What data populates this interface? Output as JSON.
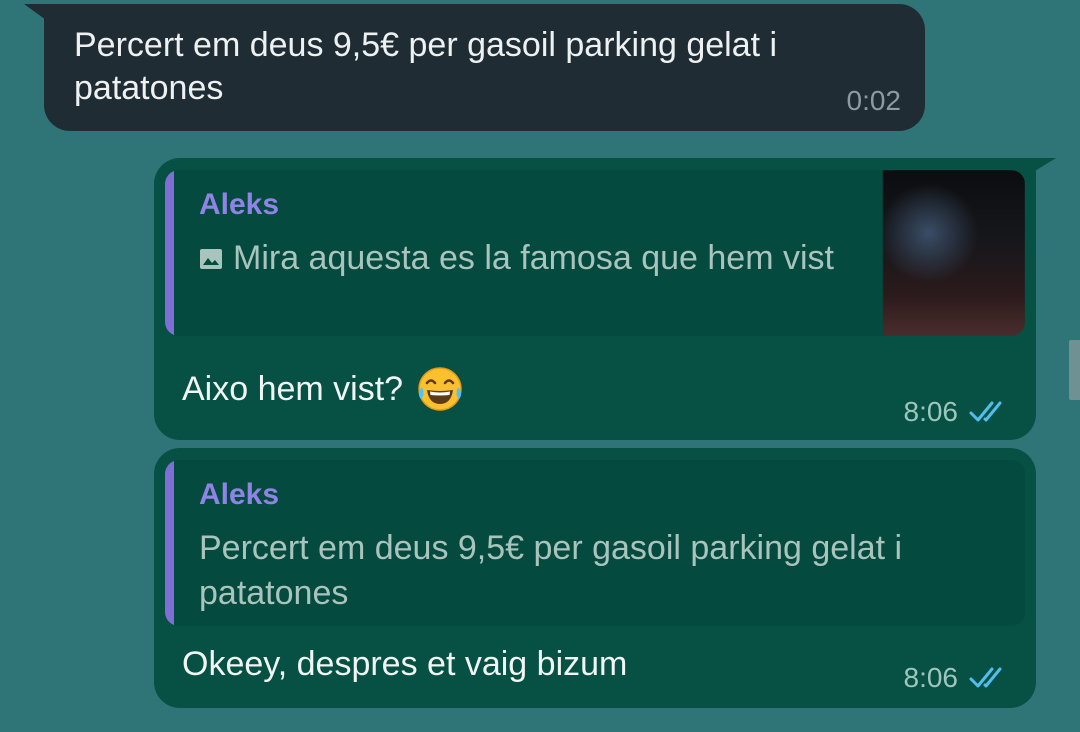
{
  "incoming_message": {
    "text": "Percert em deus 9,5€ per gasoil parking gelat i patatones",
    "time": "0:02"
  },
  "outgoing_messages": [
    {
      "quote": {
        "author": "Aleks",
        "text": "Mira aquesta es la famosa que hem vist",
        "media_icon": "photo-icon",
        "has_thumbnail": true
      },
      "text": "Aixo hem vist?",
      "emoji": "face-with-tears-of-joy",
      "time": "8:06",
      "status": "read-double-check"
    },
    {
      "quote": {
        "author": "Aleks",
        "text": "Percert em deus 9,5€ per gasoil parking gelat i patatones"
      },
      "text": "Okeey, despres et vaig bizum",
      "time": "8:06",
      "status": "read-double-check"
    }
  ],
  "colors": {
    "background": "#2f7476",
    "incoming_bubble": "#1f2c33",
    "outgoing_bubble": "#065044",
    "quote_bar": "#7e6ed6",
    "read_ticks": "#53bdeb"
  }
}
